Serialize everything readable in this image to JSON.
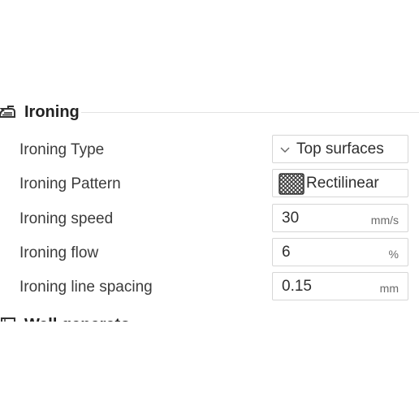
{
  "section": {
    "title": "Ironing",
    "icon": "iron-icon"
  },
  "rows": [
    {
      "label": "Ironing Type",
      "value": "Top surfaces",
      "kind": "dropdown"
    },
    {
      "label": "Ironing Pattern",
      "value": "Rectilinear",
      "kind": "pattern"
    },
    {
      "label": "Ironing speed",
      "value": "30",
      "unit": "mm/s",
      "kind": "number"
    },
    {
      "label": "Ironing flow",
      "value": "6",
      "unit": "%",
      "kind": "number"
    },
    {
      "label": "Ironing line spacing",
      "value": "0.15",
      "unit": "mm",
      "kind": "number"
    }
  ],
  "next_section": {
    "title": "Wall generator",
    "icon": "wall-generator-icon"
  },
  "colors": {
    "text": "#3b3b3b",
    "border": "#d6d6d6",
    "unit": "#6a6a6a",
    "rule": "#e3e3e3"
  }
}
